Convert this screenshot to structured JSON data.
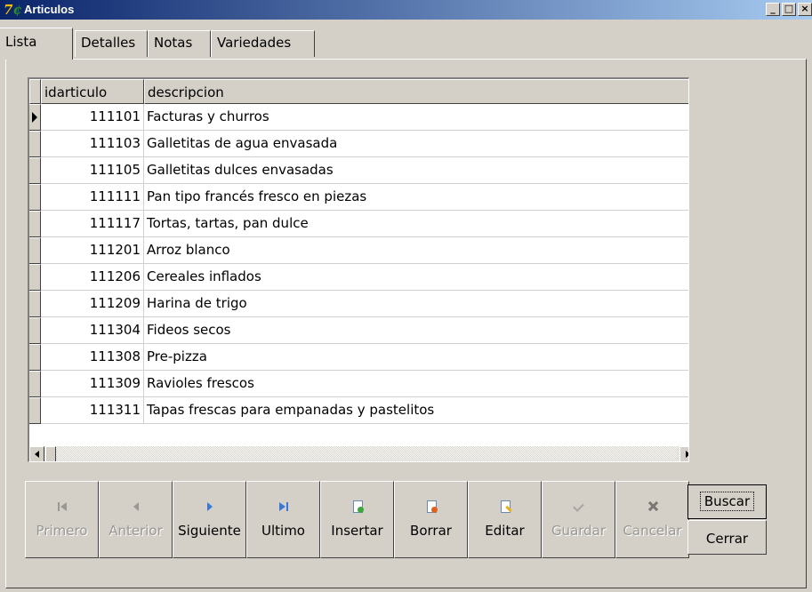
{
  "window": {
    "title": "Articulos",
    "icon": "app-logo-icon",
    "min_label": "_",
    "max_label": "□",
    "close_label": "×"
  },
  "tabs": [
    {
      "label": "Lista",
      "active": true
    },
    {
      "label": "Detalles",
      "active": false
    },
    {
      "label": "Notas",
      "active": false
    },
    {
      "label": "Variedades",
      "active": false
    }
  ],
  "grid": {
    "columns": [
      "idarticulo",
      "descripcion"
    ],
    "rows": [
      {
        "id": "111101",
        "desc": "Facturas y churros"
      },
      {
        "id": "111103",
        "desc": "Galletitas de agua envasada"
      },
      {
        "id": "111105",
        "desc": "Galletitas dulces envasadas"
      },
      {
        "id": "111111",
        "desc": "Pan tipo francés fresco en piezas"
      },
      {
        "id": "111117",
        "desc": "Tortas, tartas, pan dulce"
      },
      {
        "id": "111201",
        "desc": "Arroz blanco"
      },
      {
        "id": "111206",
        "desc": "Cereales inflados"
      },
      {
        "id": "111209",
        "desc": "Harina de trigo"
      },
      {
        "id": "111304",
        "desc": "Fideos secos"
      },
      {
        "id": "111308",
        "desc": "Pre-pizza"
      },
      {
        "id": "111309",
        "desc": "Ravioles frescos"
      },
      {
        "id": "111311",
        "desc": "Tapas frescas para empanadas y pastelitos"
      }
    ],
    "current_row": 0
  },
  "navigator": [
    {
      "label": "Primero",
      "icon": "first-record-icon",
      "enabled": false
    },
    {
      "label": "Anterior",
      "icon": "prior-record-icon",
      "enabled": false
    },
    {
      "label": "Siguiente",
      "icon": "next-record-icon",
      "enabled": true
    },
    {
      "label": "Ultimo",
      "icon": "last-record-icon",
      "enabled": true
    },
    {
      "label": "Insertar",
      "icon": "insert-doc-icon",
      "enabled": true
    },
    {
      "label": "Borrar",
      "icon": "delete-doc-icon",
      "enabled": true
    },
    {
      "label": "Editar",
      "icon": "edit-doc-icon",
      "enabled": true
    },
    {
      "label": "Guardar",
      "icon": "check-icon",
      "enabled": false
    },
    {
      "label": "Cancelar",
      "icon": "cancel-x-icon",
      "enabled": false
    }
  ],
  "actions": {
    "search_label": "Buscar",
    "close_label": "Cerrar"
  },
  "colors": {
    "titlebar_start": "#0a246a",
    "titlebar_end": "#a6caf0",
    "face": "#d4d0c8"
  }
}
